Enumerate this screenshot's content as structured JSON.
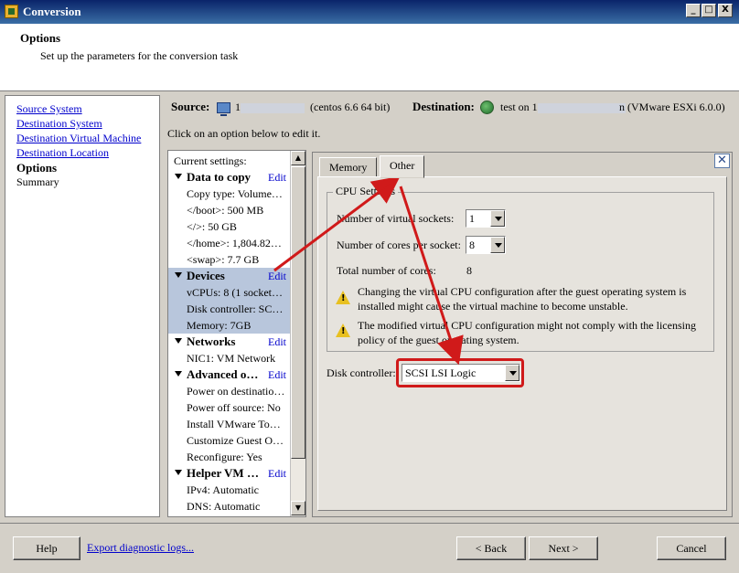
{
  "window": {
    "title": "Conversion",
    "minimize": "_",
    "maximize": "□",
    "close": "X"
  },
  "header": {
    "title": "Options",
    "subtitle": "Set up the parameters for the conversion task"
  },
  "steps": [
    {
      "label": "Source System",
      "state": "link"
    },
    {
      "label": "Destination System",
      "state": "link"
    },
    {
      "label": "Destination Virtual Machine",
      "state": "link"
    },
    {
      "label": "Destination Location",
      "state": "link"
    },
    {
      "label": "Options",
      "state": "active"
    },
    {
      "label": "Summary",
      "state": "plain"
    }
  ],
  "source": {
    "label": "Source:",
    "host_prefix": "1",
    "detail": "(centos 6.6 64 bit)"
  },
  "destination": {
    "label": "Destination:",
    "prefix": "test on 1",
    "detail": "n (VMware ESXi 6.0.0)"
  },
  "hint": "Click on an option below to edit it.",
  "settings": {
    "current_label": "Current settings:",
    "edit_label": "Edit",
    "rows": [
      {
        "type": "hdr",
        "text": "Data to copy",
        "edit": true
      },
      {
        "type": "item",
        "text": "Copy type: Volume…"
      },
      {
        "type": "item",
        "text": "</boot>: 500 MB"
      },
      {
        "type": "item",
        "text": "</>: 50 GB"
      },
      {
        "type": "item",
        "text": "</home>: 1,804.82…"
      },
      {
        "type": "item",
        "text": "<swap>: 7.7 GB"
      },
      {
        "type": "hdr",
        "text": "Devices",
        "edit": true,
        "selected": true
      },
      {
        "type": "item",
        "text": "vCPUs: 8 (1 socket…",
        "selected": true
      },
      {
        "type": "item",
        "text": "Disk controller: SC…",
        "selected": true
      },
      {
        "type": "item",
        "text": "Memory: 7GB",
        "selected": true
      },
      {
        "type": "hdr",
        "text": "Networks",
        "edit": true
      },
      {
        "type": "item",
        "text": "NIC1: VM Network"
      },
      {
        "type": "hdr",
        "text": "Advanced o…",
        "edit": true
      },
      {
        "type": "item",
        "text": "Power on destinatio…"
      },
      {
        "type": "item",
        "text": "Power off source: No"
      },
      {
        "type": "item",
        "text": "Install VMware To…"
      },
      {
        "type": "item",
        "text": "Customize Guest O…"
      },
      {
        "type": "item",
        "text": "Reconfigure: Yes"
      },
      {
        "type": "hdr",
        "text": "Helper VM …",
        "edit": true
      },
      {
        "type": "item",
        "text": "IPv4: Automatic"
      },
      {
        "type": "item",
        "text": "DNS: Automatic"
      }
    ]
  },
  "tabs": [
    {
      "label": "Memory",
      "active": false
    },
    {
      "label": "Other",
      "active": true
    }
  ],
  "cpu": {
    "group_label": "CPU Settings",
    "sockets_label": "Number of virtual sockets:",
    "sockets_value": "1",
    "cores_label": "Number of cores per socket:",
    "cores_value": "8",
    "total_label": "Total number of cores:",
    "total_value": "8",
    "warning1": "Changing the virtual CPU configuration after the guest operating system is installed might cause the virtual machine to become unstable.",
    "warning2": "The modified virtual CPU configuration might not comply with the licensing policy of the guest operating system."
  },
  "disk": {
    "label": "Disk controller:",
    "value": "SCSI LSI Logic"
  },
  "footer": {
    "help": "Help",
    "export_logs": "Export diagnostic logs...",
    "back": "< Back",
    "next": "Next >",
    "cancel": "Cancel"
  },
  "colors": {
    "annotation_red": "#d01a1a",
    "selection": "#b8c6dc",
    "link": "#0000cc"
  }
}
